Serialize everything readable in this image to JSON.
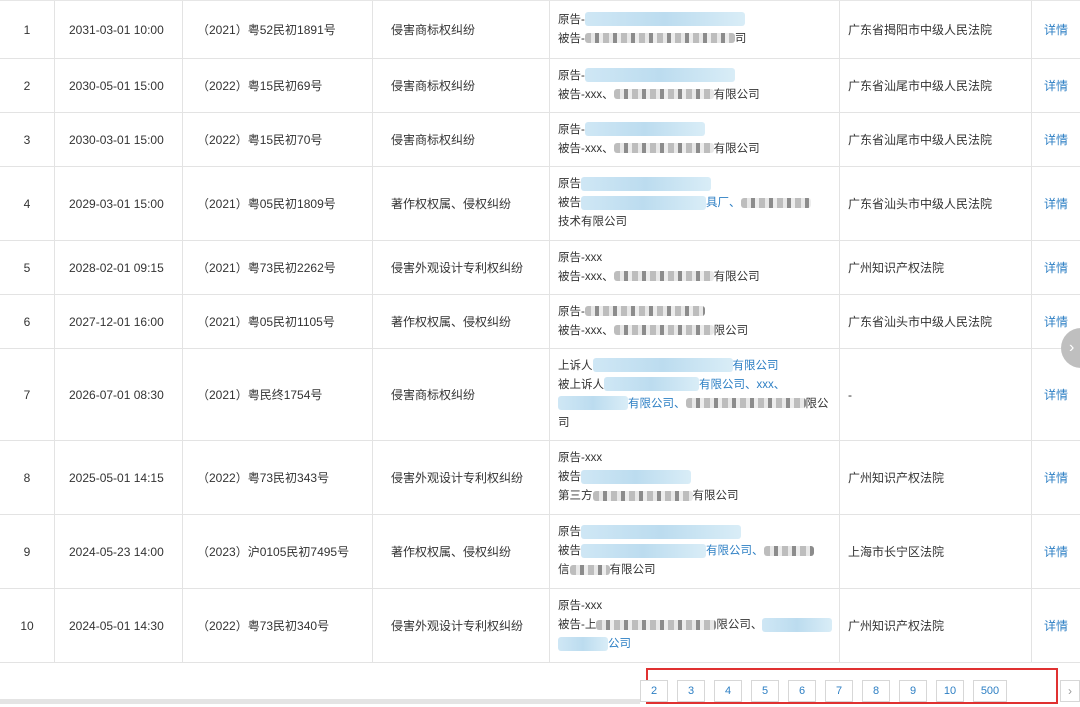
{
  "rows": [
    {
      "no": "1",
      "date": "2031-03-01 10:00",
      "case": "（2021）粤52民初1891号",
      "reason": "侵害商标权纠纷",
      "p1": "原告-",
      "p2": "被告-",
      "p2tail": "司",
      "p3": "",
      "court": "广东省揭阳市中级人民法院",
      "op": "详情"
    },
    {
      "no": "2",
      "date": "2030-05-01 15:00",
      "case": "（2022）粤15民初69号",
      "reason": "侵害商标权纠纷",
      "p1": "原告-",
      "p2": "被告-xxx、",
      "p2tail": "有限公司",
      "p3": "",
      "court": "广东省汕尾市中级人民法院",
      "op": "详情"
    },
    {
      "no": "3",
      "date": "2030-03-01 15:00",
      "case": "（2022）粤15民初70号",
      "reason": "侵害商标权纠纷",
      "p1": "原告-",
      "p2": "被告-xxx、",
      "p2tail": "有限公司",
      "p3": "",
      "court": "广东省汕尾市中级人民法院",
      "op": "详情"
    },
    {
      "no": "4",
      "date": "2029-03-01 15:00",
      "case": "（2021）粤05民初1809号",
      "reason": "著作权权属、侵权纠纷",
      "p1": "原告",
      "p2": "被告",
      "p2tail": "具厂、",
      "p3": "技术有限公司",
      "court": "广东省汕头市中级人民法院",
      "op": "详情"
    },
    {
      "no": "5",
      "date": "2028-02-01 09:15",
      "case": "（2021）粤73民初2262号",
      "reason": "侵害外观设计专利权纠纷",
      "p1": "原告-xxx",
      "p2": "被告-xxx、",
      "p2tail": "有限公司",
      "p3": "",
      "court": "广州知识产权法院",
      "op": "详情"
    },
    {
      "no": "6",
      "date": "2027-12-01 16:00",
      "case": "（2021）粤05民初1105号",
      "reason": "著作权权属、侵权纠纷",
      "p1": "原告-",
      "p2": "被告-xxx、",
      "p2tail": "限公司",
      "p3": "",
      "court": "广东省汕头市中级人民法院",
      "op": "详情"
    },
    {
      "no": "7",
      "date": "2026-07-01 08:30",
      "case": "（2021）粤民终1754号",
      "reason": "侵害商标权纠纷",
      "p1": "上诉人",
      "p1tail": "有限公司",
      "p2": "被上诉人",
      "p2tail": "有限公司、xxx、",
      "p3": "有限公司、",
      "p3tail": "限公",
      "p4": "司",
      "court": "-",
      "op": "详情"
    },
    {
      "no": "8",
      "date": "2025-05-01 14:15",
      "case": "（2022）粤73民初343号",
      "reason": "侵害外观设计专利权纠纷",
      "p1": "原告-xxx",
      "p2": "被告",
      "p2tail": "",
      "p3": "第三方",
      "p3tail": "有限公司",
      "court": "广州知识产权法院",
      "op": "详情"
    },
    {
      "no": "9",
      "date": "2024-05-23 14:00",
      "case": "（2023）沪0105民初7495号",
      "reason": "著作权权属、侵权纠纷",
      "p1": "原告",
      "p2": "被告",
      "p2tail": "有限公司、",
      "p3": "信",
      "p3tail": "有限公司",
      "court": "上海市长宁区法院",
      "op": "详情"
    },
    {
      "no": "10",
      "date": "2024-05-01 14:30",
      "case": "（2022）粤73民初340号",
      "reason": "侵害外观设计专利权纠纷",
      "p1": "原告-xxx",
      "p2": "被告-上",
      "p2tail": "限公司、",
      "p3": "公司",
      "court": "广州知识产权法院",
      "op": "详情"
    }
  ],
  "pagination": {
    "pages": [
      "2",
      "3",
      "4",
      "5",
      "6",
      "7",
      "8",
      "9",
      "10",
      "500"
    ],
    "next": "›"
  },
  "icons": {
    "scroll": "chevron-right-icon"
  }
}
